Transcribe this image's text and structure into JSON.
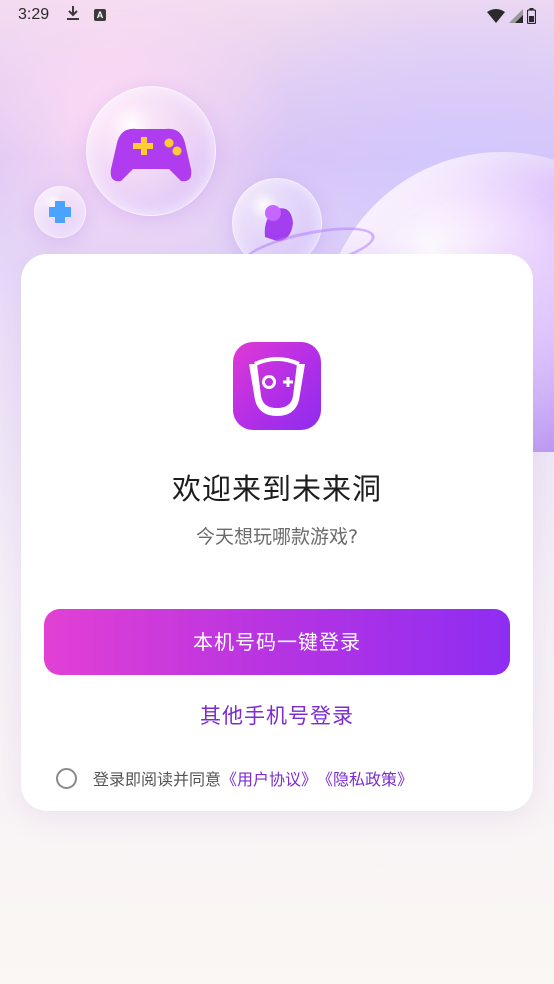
{
  "status_bar": {
    "time": "3:29",
    "download_icon": "download-icon",
    "a_badge": "A"
  },
  "card": {
    "title": "欢迎来到未来洞",
    "subtitle": "今天想玩哪款游戏?",
    "primary_button": "本机号码一键登录",
    "secondary_link": "其他手机号登录",
    "agreement": {
      "prefix": "登录即阅读并同意",
      "user_agreement": "《用户协议》",
      "privacy_policy": "《隐私政策》"
    }
  },
  "colors": {
    "accent_start": "#e240d4",
    "accent_end": "#8e2df2",
    "link": "#7c2cd0"
  }
}
